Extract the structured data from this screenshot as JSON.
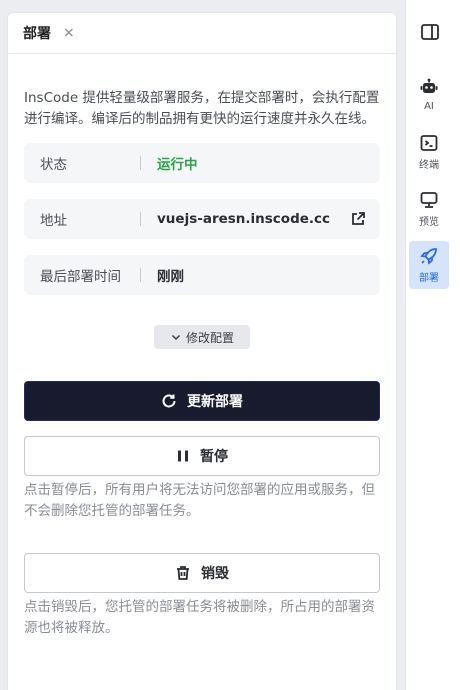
{
  "panel": {
    "title": "部署",
    "close_glyph": "×",
    "intro": "InsCode 提供轻量级部署服务，在提交部署时，会执行配置进行编译。编译后的制品拥有更快的运行速度并永久在线。"
  },
  "info": {
    "status_label": "状态",
    "status_value": "运行中",
    "address_label": "地址",
    "address_value": "vuejs-aresn.inscode.cc",
    "time_label": "最后部署时间",
    "time_value": "刚刚"
  },
  "config_button": "修改配置",
  "actions": {
    "redeploy": "更新部署",
    "pause": "暂停",
    "pause_hint": "点击暂停后，所有用户将无法访问您部署的应用或服务，但不会删除您托管的部署任务。",
    "destroy": "销毁",
    "destroy_hint": "点击销毁后，您托管的部署任务将被删除，所占用的部署资源也将被释放。"
  },
  "sidebar": {
    "items": [
      {
        "label": "AI",
        "icon": "robot-icon"
      },
      {
        "label": "终端",
        "icon": "terminal-icon"
      },
      {
        "label": "预览",
        "icon": "monitor-icon"
      },
      {
        "label": "部署",
        "icon": "rocket-icon",
        "active": true
      }
    ]
  },
  "colors": {
    "running": "#2ea34b",
    "primary_button": "#181a2e",
    "active_sidebar_bg": "#d6e4fb",
    "active_sidebar_fg": "#2a6de0"
  }
}
